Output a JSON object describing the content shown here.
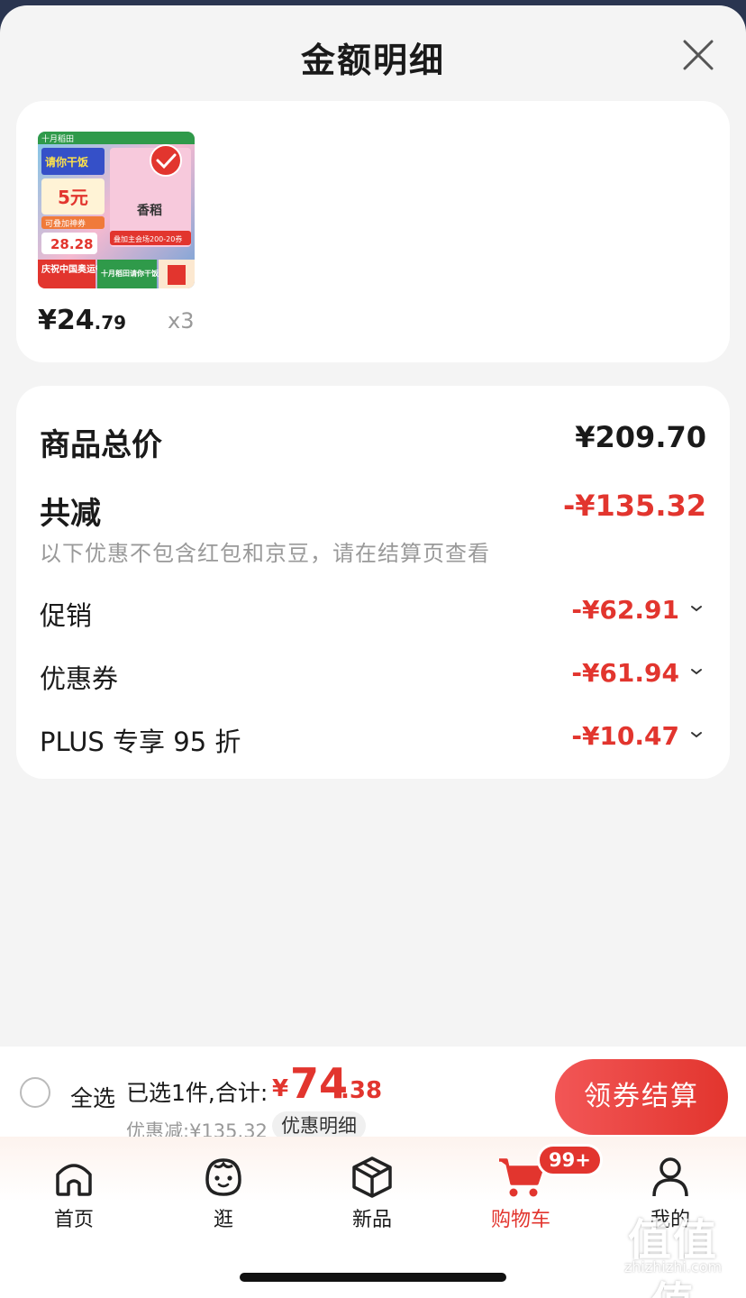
{
  "header": {
    "title": "金额明细"
  },
  "product": {
    "price_symbol": "¥",
    "price_int": "24",
    "price_dec": ".79",
    "quantity": "x3",
    "image_text": {
      "brand": "十月稻田",
      "top": "请你干饭",
      "discount": "5元",
      "stack_tag": "可叠加神券",
      "price": "28.28",
      "caption_left": "庆祝中国奥运夺金",
      "caption_mid": "十月稻田请你干饭",
      "promo": "叠加主会场200-20券",
      "center": "香稻"
    }
  },
  "summary": {
    "total_label": "商品总价",
    "total_value": "¥209.70",
    "reduce_label": "共减",
    "reduce_value": "-¥135.32",
    "note": "以下优惠不包含红包和京豆，请在结算页查看",
    "items": [
      {
        "label": "促销",
        "value": "-¥62.91"
      },
      {
        "label": "优惠券",
        "value": "-¥61.94"
      },
      {
        "label": "PLUS 专享 95 折",
        "value": "-¥10.47"
      }
    ]
  },
  "bottom_bar": {
    "select_all": "全选",
    "selected_text": "已选1件,合计:",
    "total_symbol": "¥",
    "total_int": "74",
    "total_dec": ".38",
    "discount_text": "优惠减:¥135.32",
    "detail_button": "优惠明细",
    "checkout_button": "领券结算"
  },
  "tabbar": {
    "items": [
      {
        "label": "首页",
        "icon": "home-icon"
      },
      {
        "label": "逛",
        "icon": "face-icon"
      },
      {
        "label": "新品",
        "icon": "cube-icon"
      },
      {
        "label": "购物车",
        "icon": "cart-icon",
        "badge": "99+",
        "active": true
      },
      {
        "label": "我的",
        "icon": "person-icon"
      }
    ]
  },
  "watermark": {
    "main": "值",
    "site": "zhizhizhi.com"
  },
  "colors": {
    "accent": "#e2352e",
    "muted": "#999999"
  }
}
